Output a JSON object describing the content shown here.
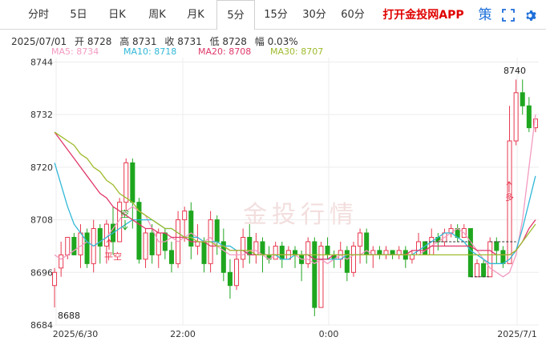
{
  "tabs": [
    "分时",
    "5日",
    "日K",
    "周K",
    "月K",
    "5分",
    "15分",
    "30分",
    "60分"
  ],
  "active_tab": "5分",
  "promo_text": "打开金投网APP",
  "icons": {
    "strategy": "策",
    "expand": "expand-icon",
    "settings": "gear-icon"
  },
  "info": {
    "date": "2025/07/01",
    "open": "开 8728",
    "high": "高 8731",
    "close": "收 8731",
    "low": "低 8728",
    "change": "幅 0.03%"
  },
  "ma": [
    {
      "label": "MA5: 8734",
      "color": "#f39ac0"
    },
    {
      "label": "MA10: 8718",
      "color": "#30b8d8"
    },
    {
      "label": "MA20: 8708",
      "color": "#e0386a"
    },
    {
      "label": "MA30: 8707",
      "color": "#9dbb2c"
    }
  ],
  "watermark": "金投行情",
  "annotations": {
    "low": "8688",
    "high": "8740",
    "empty": "平空",
    "empty2": "空",
    "long": "多"
  },
  "chart_data": {
    "type": "candlestick",
    "y_ticks": [
      8684,
      8696,
      8708,
      8720,
      8732,
      8744
    ],
    "ylim": [
      8684,
      8745
    ],
    "x_ticks": [
      "2025/6/30",
      "22:00",
      "0:00",
      "2025/7/1"
    ],
    "colors": {
      "up": "#e8384f",
      "down": "#1fa61f"
    },
    "candles": [
      [
        8693,
        8696,
        8688,
        8697
      ],
      [
        8697,
        8700,
        8695,
        8703
      ],
      [
        8700,
        8704,
        8699,
        8704
      ],
      [
        8704,
        8700,
        8700,
        8705
      ],
      [
        8700,
        8705,
        8697,
        8707
      ],
      [
        8705,
        8698,
        8697,
        8706
      ],
      [
        8698,
        8706,
        8696,
        8708
      ],
      [
        8706,
        8702,
        8698,
        8707
      ],
      [
        8702,
        8707,
        8698,
        8708
      ],
      [
        8707,
        8703,
        8700,
        8711
      ],
      [
        8703,
        8712,
        8703,
        8713
      ],
      [
        8712,
        8721,
        8710,
        8722
      ],
      [
        8721,
        8712,
        8706,
        8722
      ],
      [
        8712,
        8699,
        8698,
        8713
      ],
      [
        8699,
        8705,
        8697,
        8706
      ],
      [
        8705,
        8700,
        8698,
        8707
      ],
      [
        8700,
        8705,
        8697,
        8706
      ],
      [
        8705,
        8701,
        8699,
        8706
      ],
      [
        8701,
        8698,
        8696,
        8703
      ],
      [
        8698,
        8708,
        8697,
        8710
      ],
      [
        8708,
        8710,
        8703,
        8711
      ],
      [
        8710,
        8702,
        8699,
        8712
      ],
      [
        8702,
        8703,
        8700,
        8707
      ],
      [
        8703,
        8698,
        8696,
        8704
      ],
      [
        8698,
        8708,
        8696,
        8710
      ],
      [
        8708,
        8703,
        8700,
        8709
      ],
      [
        8703,
        8696,
        8694,
        8706
      ],
      [
        8696,
        8693,
        8690,
        8699
      ],
      [
        8693,
        8699,
        8692,
        8701
      ],
      [
        8699,
        8704,
        8697,
        8706
      ],
      [
        8704,
        8700,
        8698,
        8707
      ],
      [
        8700,
        8703,
        8698,
        8705
      ],
      [
        8703,
        8700,
        8696,
        8704
      ],
      [
        8700,
        8699,
        8698,
        8702
      ],
      [
        8699,
        8702,
        8699,
        8703
      ],
      [
        8702,
        8699,
        8697,
        8703
      ],
      [
        8699,
        8701,
        8699,
        8702
      ],
      [
        8701,
        8700,
        8697,
        8702
      ],
      [
        8700,
        8698,
        8694,
        8701
      ],
      [
        8698,
        8703,
        8697,
        8704
      ],
      [
        8703,
        8688,
        8686,
        8704
      ],
      [
        8688,
        8702,
        8688,
        8703
      ],
      [
        8702,
        8700,
        8699,
        8704
      ],
      [
        8700,
        8699,
        8697,
        8701
      ],
      [
        8699,
        8701,
        8697,
        8703
      ],
      [
        8701,
        8696,
        8694,
        8702
      ],
      [
        8696,
        8702,
        8695,
        8703
      ],
      [
        8702,
        8705,
        8698,
        8706
      ],
      [
        8705,
        8700,
        8698,
        8706
      ],
      [
        8700,
        8701,
        8697,
        8702
      ],
      [
        8701,
        8700,
        8699,
        8702
      ],
      [
        8700,
        8701,
        8699,
        8702
      ],
      [
        8701,
        8700,
        8699,
        8701
      ],
      [
        8700,
        8701,
        8699,
        8702
      ],
      [
        8701,
        8699,
        8697,
        8702
      ],
      [
        8699,
        8700,
        8698,
        8701
      ],
      [
        8700,
        8703,
        8700,
        8705
      ],
      [
        8703,
        8700,
        8700,
        8703
      ],
      [
        8700,
        8704,
        8700,
        8706
      ],
      [
        8704,
        8703,
        8701,
        8705
      ],
      [
        8703,
        8705,
        8702,
        8706
      ],
      [
        8705,
        8706,
        8704,
        8707
      ],
      [
        8706,
        8704,
        8703,
        8707
      ],
      [
        8704,
        8706,
        8704,
        8707
      ],
      [
        8706,
        8695,
        8695,
        8706
      ],
      [
        8695,
        8698,
        8695,
        8699
      ],
      [
        8698,
        8695,
        8695,
        8699
      ],
      [
        8695,
        8703,
        8695,
        8704
      ],
      [
        8703,
        8701,
        8698,
        8704
      ],
      [
        8701,
        8698,
        8697,
        8702
      ],
      [
        8698,
        8726,
        8698,
        8734
      ],
      [
        8726,
        8737,
        8725,
        8740
      ],
      [
        8737,
        8734,
        8732,
        8740
      ],
      [
        8734,
        8729,
        8728,
        8736
      ],
      [
        8729,
        8731,
        8728,
        8731
      ]
    ],
    "ma5": [
      8700,
      8699,
      8700,
      8701,
      8702,
      8703,
      8702,
      8703,
      8704,
      8706,
      8708,
      8710,
      8711,
      8710,
      8709,
      8706,
      8703,
      8703,
      8704,
      8703,
      8704,
      8705,
      8704,
      8703,
      8704,
      8702,
      8701,
      8700,
      8700,
      8700,
      8701,
      8701,
      8700,
      8699,
      8700,
      8700,
      8700,
      8700,
      8699,
      8699,
      8698,
      8699,
      8698,
      8699,
      8700,
      8699,
      8700,
      8700,
      8701,
      8700,
      8700,
      8700,
      8700,
      8700,
      8700,
      8700,
      8700,
      8701,
      8702,
      8703,
      8704,
      8705,
      8706,
      8705,
      8703,
      8701,
      8699,
      8697,
      8696,
      8695,
      8696,
      8700,
      8708,
      8720,
      8732
    ],
    "ma10": [
      8721,
      8716,
      8711,
      8707,
      8705,
      8703,
      8702,
      8703,
      8704,
      8705,
      8706,
      8707,
      8708,
      8708,
      8708,
      8708,
      8707,
      8706,
      8706,
      8705,
      8704,
      8704,
      8704,
      8703,
      8703,
      8703,
      8702,
      8702,
      8701,
      8701,
      8700,
      8700,
      8700,
      8700,
      8700,
      8699,
      8699,
      8700,
      8700,
      8700,
      8699,
      8699,
      8699,
      8699,
      8699,
      8700,
      8700,
      8700,
      8700,
      8700,
      8700,
      8700,
      8700,
      8700,
      8700,
      8700,
      8701,
      8702,
      8703,
      8704,
      8705,
      8705,
      8704,
      8703,
      8701,
      8700,
      8699,
      8698,
      8698,
      8698,
      8699,
      8701,
      8706,
      8712,
      8718
    ],
    "ma20": [
      8728,
      8726,
      8724,
      8722,
      8720,
      8718,
      8716,
      8714,
      8713,
      8711,
      8710,
      8709,
      8708,
      8707,
      8706,
      8706,
      8705,
      8705,
      8704,
      8704,
      8704,
      8703,
      8703,
      8703,
      8702,
      8702,
      8702,
      8701,
      8701,
      8701,
      8700,
      8700,
      8700,
      8700,
      8700,
      8700,
      8700,
      8700,
      8700,
      8700,
      8699,
      8699,
      8699,
      8700,
      8700,
      8700,
      8700,
      8700,
      8700,
      8700,
      8700,
      8700,
      8700,
      8700,
      8700,
      8701,
      8701,
      8701,
      8702,
      8702,
      8702,
      8702,
      8702,
      8702,
      8702,
      8701,
      8701,
      8701,
      8700,
      8700,
      8700,
      8701,
      8703,
      8706,
      8708
    ],
    "ma30": [
      8728,
      8727,
      8726,
      8725,
      8723,
      8722,
      8720,
      8719,
      8717,
      8716,
      8714,
      8713,
      8712,
      8710,
      8709,
      8708,
      8707,
      8706,
      8706,
      8705,
      8704,
      8704,
      8703,
      8703,
      8703,
      8702,
      8702,
      8701,
      8701,
      8701,
      8701,
      8700,
      8700,
      8700,
      8700,
      8700,
      8700,
      8700,
      8700,
      8700,
      8700,
      8700,
      8700,
      8700,
      8700,
      8700,
      8700,
      8700,
      8700,
      8700,
      8700,
      8700,
      8700,
      8700,
      8700,
      8700,
      8700,
      8700,
      8700,
      8700,
      8700,
      8700,
      8700,
      8700,
      8700,
      8700,
      8700,
      8700,
      8700,
      8700,
      8700,
      8701,
      8703,
      8705,
      8707
    ]
  }
}
